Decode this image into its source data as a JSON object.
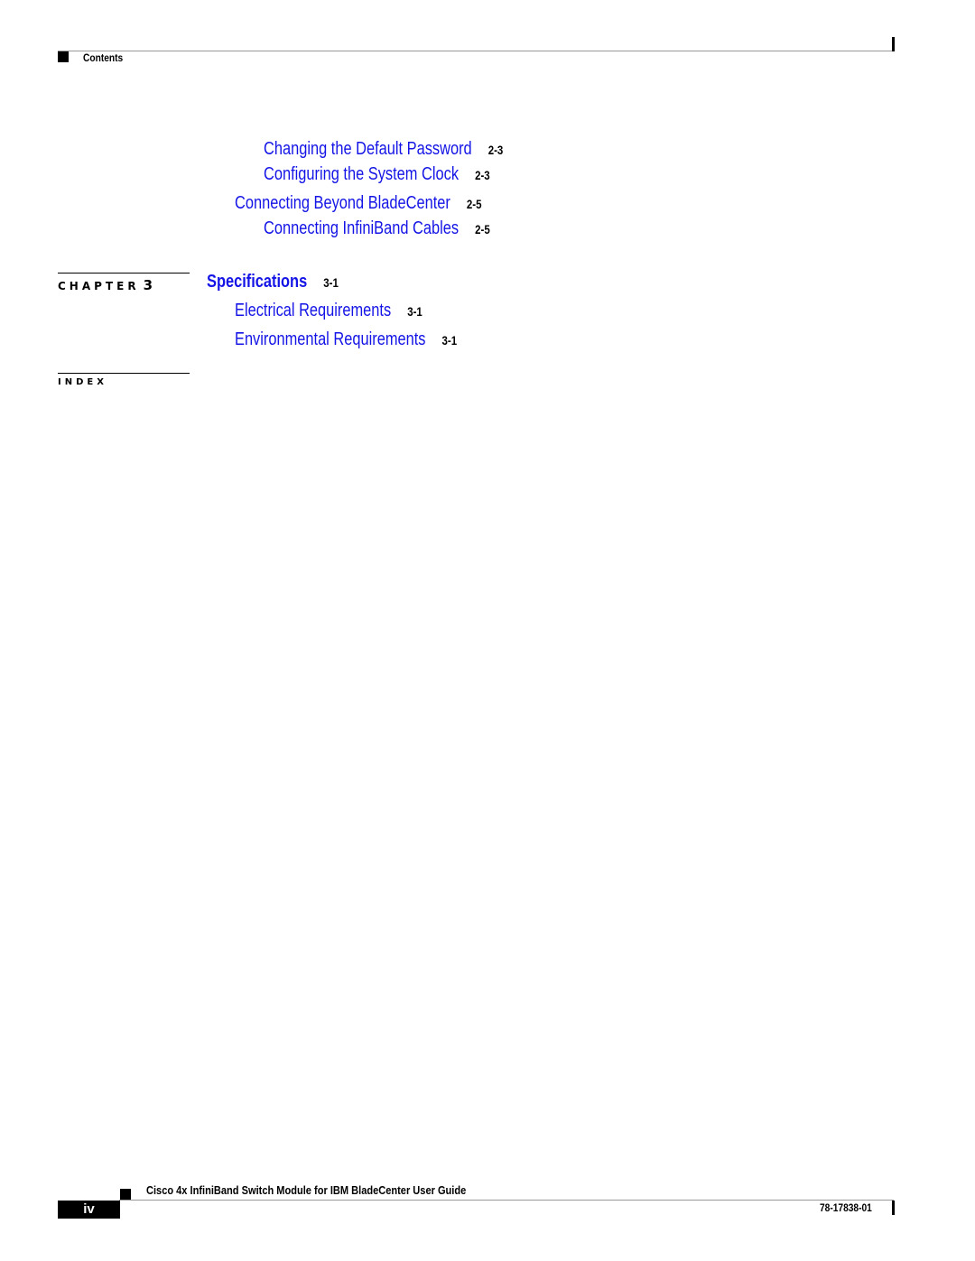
{
  "header": {
    "section_label": "Contents"
  },
  "toc": {
    "entries": [
      {
        "title": "Changing the Default Password",
        "page": "2-3"
      },
      {
        "title": "Configuring the System Clock",
        "page": "2-3"
      },
      {
        "title": "Connecting Beyond BladeCenter",
        "page": "2-5"
      },
      {
        "title": "Connecting InfiniBand Cables",
        "page": "2-5"
      }
    ],
    "chapter3": {
      "label": "CHAPTER",
      "number": "3",
      "title": "Specifications",
      "page": "3-1",
      "entries": [
        {
          "title": "Electrical Requirements",
          "page": "3-1"
        },
        {
          "title": "Environmental Requirements",
          "page": "3-1"
        }
      ]
    },
    "index": {
      "label": "INDEX"
    }
  },
  "footer": {
    "guide_title": "Cisco 4x InfiniBand Switch Module for IBM BladeCenter User Guide",
    "page_number": "iv",
    "doc_number": "78-17838-01"
  },
  "colors": {
    "link": "#1414e6",
    "text": "#000000"
  }
}
